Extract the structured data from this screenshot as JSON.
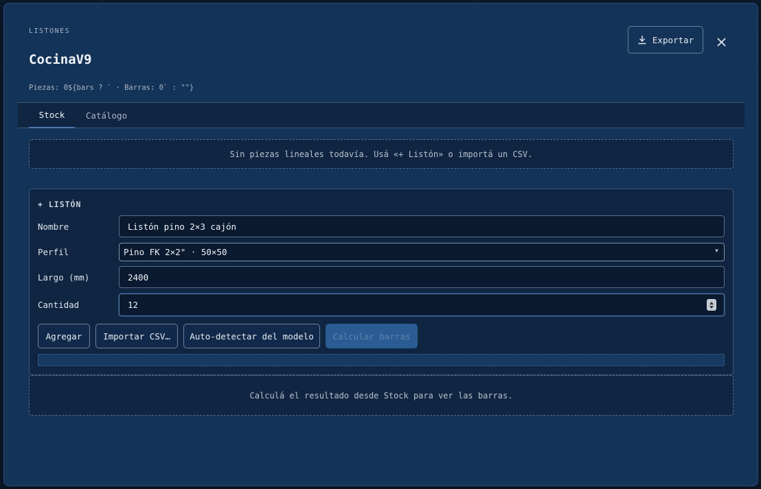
{
  "modal": {
    "eyebrow": "LISTONES",
    "title": "CocinaV9",
    "subtitle": "Piezas: 0${bars ? ` · Barras: 0` : \"\"}",
    "export_label": "Exportar"
  },
  "tabs": [
    {
      "label": "Stock",
      "active": true
    },
    {
      "label": "Catálogo",
      "active": false
    }
  ],
  "stock": {
    "empty_message": "Sin piezas lineales todavía. Usá «+ Listón» o importá un CSV."
  },
  "form": {
    "heading": "+ LISTÓN",
    "nombre_label": "Nombre",
    "nombre_value": "Listón pino 2×3 cajón",
    "perfil_label": "Perfil",
    "perfil_value": "Pino FK 2×2\" · 50×50",
    "largo_label": "Largo (mm)",
    "largo_value": "2400",
    "cantidad_label": "Cantidad",
    "cantidad_value": "12",
    "buttons": {
      "agregar": "Agregar",
      "importar": "Importar CSV…",
      "autodetect": "Auto-detectar del modelo",
      "calcular": "Calcular barras"
    },
    "progress": 0
  },
  "result": {
    "empty_message": "Calculá el resultado desde Stock para ver las barras."
  },
  "icons": {
    "export": "download-icon",
    "close": "close-icon",
    "select": "chevron-down-icon",
    "spinner": "number-stepper-icon"
  },
  "colors": {
    "modal_bg": "#143358",
    "panel_bg": "#0f2541",
    "accent": "#4e79ad",
    "disabled_button": "#2a5c93"
  }
}
